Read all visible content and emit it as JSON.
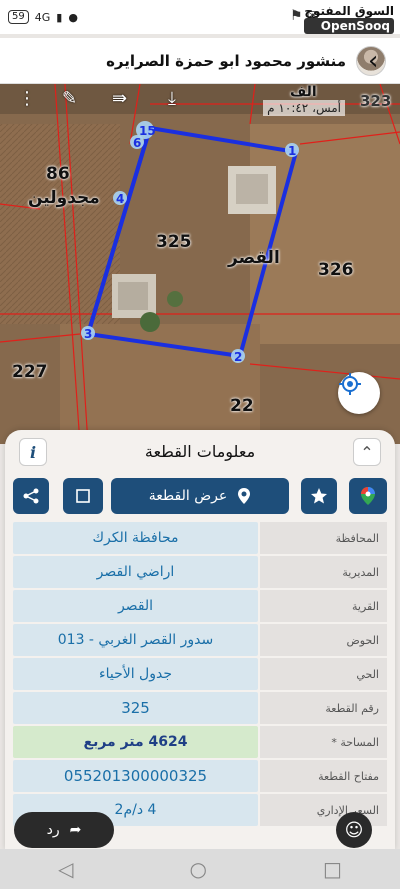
{
  "status_bar": {
    "battery": "59",
    "network": "4G",
    "brand_ar": "السوق المفتوح",
    "brand_en": "OpenSooq"
  },
  "header": {
    "title": "منشور محمود ابو حمزة الصرايره"
  },
  "map": {
    "timestamp": "أمس، ١٠:٤٢ م",
    "top_corner_number": "323",
    "top_partial_label": "الف",
    "labels": {
      "neighbor_86": "86",
      "mjdoleen": "مجدولين",
      "plot_325": "325",
      "plot_326": "326",
      "plot_227": "227",
      "plot_22": "22",
      "qasr": "القصر"
    },
    "vertices": [
      "15",
      "1",
      "6",
      "4",
      "3",
      "2"
    ]
  },
  "panel": {
    "title": "معلومات القطعة",
    "info_icon": "i",
    "show_plot_button": "عرض القطعة",
    "rows": [
      {
        "label": "المحافظة",
        "value": "محافظة الكرك"
      },
      {
        "label": "المديرية",
        "value": "اراضي القصر"
      },
      {
        "label": "القرية",
        "value": "القصر"
      },
      {
        "label": "الحوض",
        "value": "سدور القصر الغربي - 013"
      },
      {
        "label": "الحي",
        "value": "جدول الأحياء"
      },
      {
        "label": "رقم القطعة",
        "value": "325"
      },
      {
        "label": "المساحة *",
        "value": "4624  متر مربع"
      },
      {
        "label": "مفتاح القطعة",
        "value": "055201300000325"
      },
      {
        "label": "السعر الإداري",
        "value": "4 د/م2"
      }
    ]
  },
  "bottom": {
    "reply_label": "رد"
  },
  "icons": {
    "back": "arrow-right-icon",
    "share": "share-icon",
    "shape": "square-outline-icon",
    "star": "star-icon",
    "maps": "google-maps-icon",
    "collapse": "chevron-up-icon",
    "locate": "crosshair-icon"
  }
}
